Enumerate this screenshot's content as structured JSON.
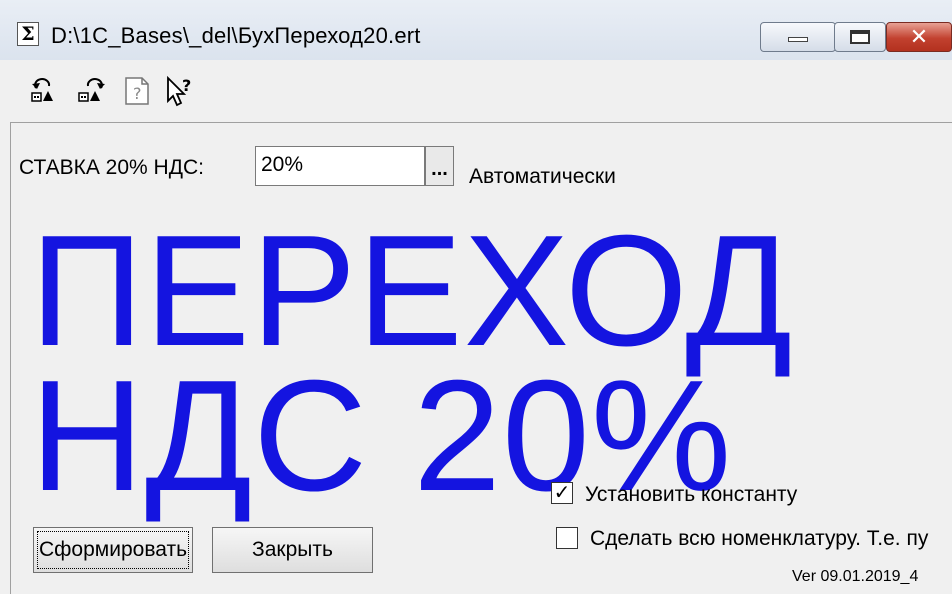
{
  "window": {
    "title": "D:\\1C_Bases\\_del\\БухПереход20.ert",
    "app_icon": "sigma-icon",
    "controls": {
      "close_symbol": "✕"
    }
  },
  "toolbar": {
    "buttons": [
      {
        "icon": "undo-icon"
      },
      {
        "icon": "redo-icon"
      },
      {
        "icon": "help-document-icon"
      },
      {
        "icon": "context-help-pointer-icon"
      }
    ]
  },
  "form": {
    "vat_label": "СТАВКА 20% НДС:",
    "vat_value": "20%",
    "vat_select_button": "...",
    "auto_label": "Автоматически",
    "headline_line1": "ПЕРЕХОД",
    "headline_line2": "НДС 20%",
    "checkbox_constant": {
      "label": "Установить константу",
      "checked": true,
      "mark": "✓"
    },
    "checkbox_nomenclature": {
      "label": "Сделать всю номенклатуру. Т.е. пу",
      "checked": false,
      "mark": ""
    },
    "button_generate": "Сформировать",
    "button_close": "Закрыть",
    "version": "Ver 09.01.2019_4"
  },
  "colors": {
    "headline": "#1414e0",
    "background": "#f0f0f0"
  }
}
